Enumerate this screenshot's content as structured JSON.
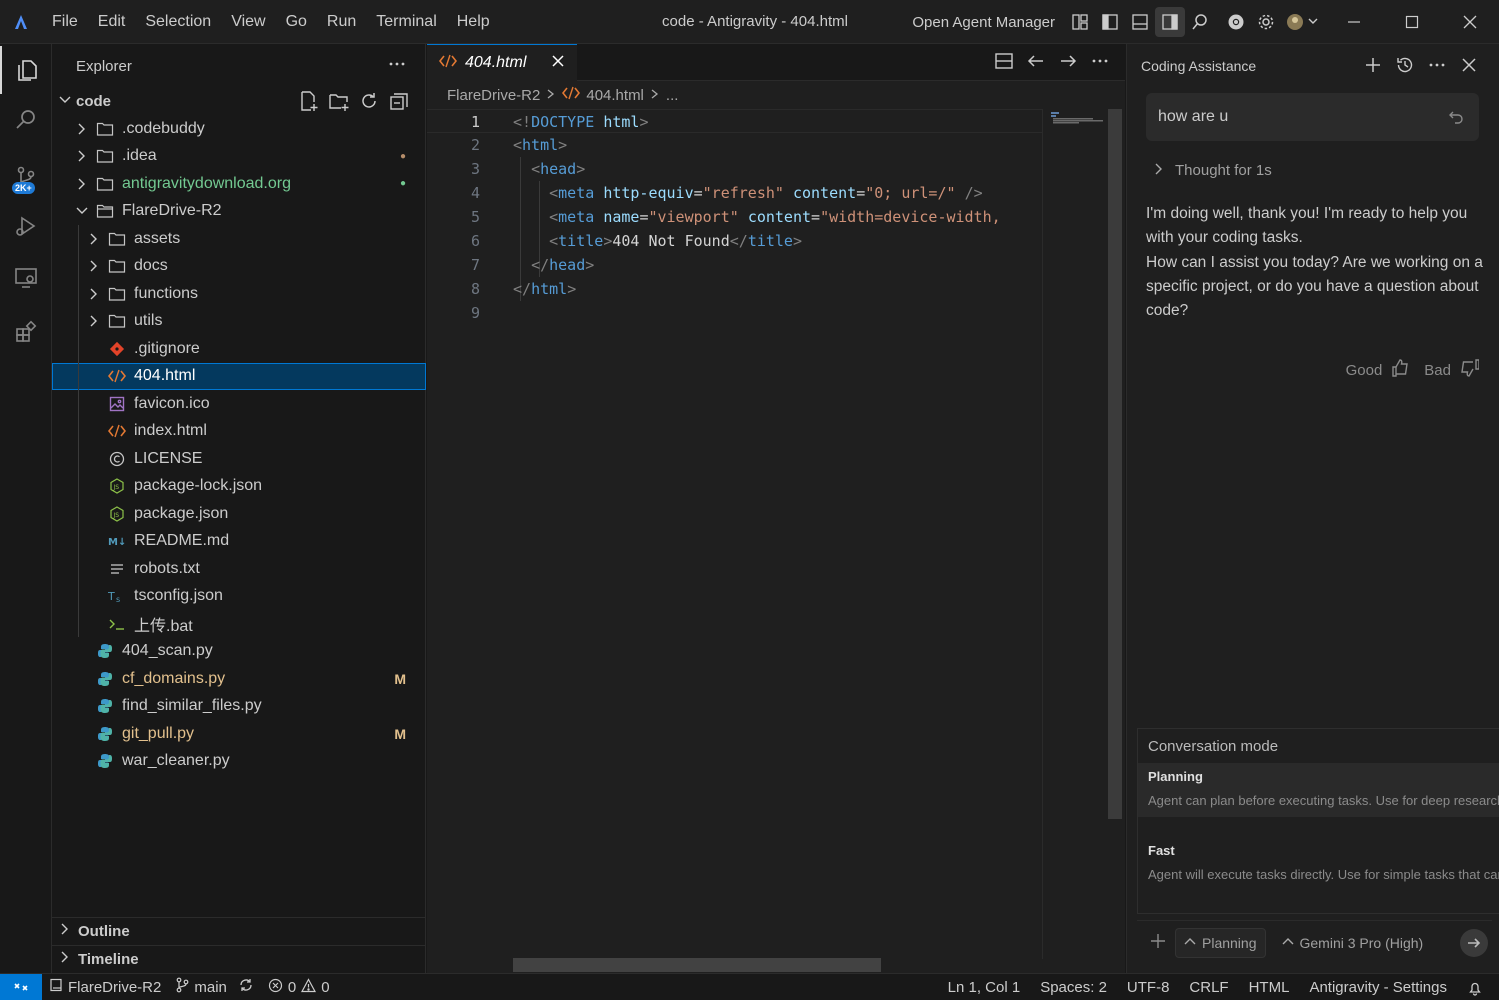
{
  "titlebar": {
    "menu": [
      "File",
      "Edit",
      "Selection",
      "View",
      "Go",
      "Run",
      "Terminal",
      "Help"
    ],
    "window_title": "code - Antigravity - 404.html",
    "open_agent_manager": "Open Agent Manager"
  },
  "activity_bar": {
    "badge": "2K+"
  },
  "explorer": {
    "title": "Explorer",
    "root": "code",
    "items": [
      {
        "name": ".codebuddy",
        "type": "folder",
        "color": "#cccccc",
        "decoration": ""
      },
      {
        "name": ".idea",
        "type": "folder",
        "color": "#cccccc",
        "decoration": "●"
      },
      {
        "name": "antigravitydownload.org",
        "type": "folder",
        "color": "#73c991",
        "decoration": "●"
      },
      {
        "name": "FlareDrive-R2",
        "type": "folder-open",
        "color": "#cccccc",
        "decoration": ""
      },
      {
        "name": "assets",
        "type": "folder",
        "color": "#cccccc",
        "decoration": ""
      },
      {
        "name": "docs",
        "type": "folder",
        "color": "#cccccc",
        "decoration": ""
      },
      {
        "name": "functions",
        "type": "folder",
        "color": "#cccccc",
        "decoration": ""
      },
      {
        "name": "utils",
        "type": "folder",
        "color": "#cccccc",
        "decoration": ""
      },
      {
        "name": ".gitignore",
        "type": "git",
        "color": "#cccccc",
        "decoration": ""
      },
      {
        "name": "404.html",
        "type": "html",
        "color": "#ffffff",
        "decoration": ""
      },
      {
        "name": "favicon.ico",
        "type": "image",
        "color": "#cccccc",
        "decoration": ""
      },
      {
        "name": "index.html",
        "type": "html",
        "color": "#cccccc",
        "decoration": ""
      },
      {
        "name": "LICENSE",
        "type": "license",
        "color": "#cccccc",
        "decoration": ""
      },
      {
        "name": "package-lock.json",
        "type": "node",
        "color": "#cccccc",
        "decoration": ""
      },
      {
        "name": "package.json",
        "type": "node",
        "color": "#cccccc",
        "decoration": ""
      },
      {
        "name": "README.md",
        "type": "markdown",
        "color": "#cccccc",
        "decoration": ""
      },
      {
        "name": "robots.txt",
        "type": "text",
        "color": "#cccccc",
        "decoration": ""
      },
      {
        "name": "tsconfig.json",
        "type": "tsconfig",
        "color": "#cccccc",
        "decoration": ""
      },
      {
        "name": "上传.bat",
        "type": "bat",
        "color": "#cccccc",
        "decoration": ""
      },
      {
        "name": "404_scan.py",
        "type": "python",
        "color": "#cccccc",
        "decoration": ""
      },
      {
        "name": "cf_domains.py",
        "type": "python",
        "color": "#e2c08d",
        "decoration": "M"
      },
      {
        "name": "find_similar_files.py",
        "type": "python",
        "color": "#cccccc",
        "decoration": ""
      },
      {
        "name": "git_pull.py",
        "type": "python",
        "color": "#e2c08d",
        "decoration": "M"
      },
      {
        "name": "war_cleaner.py",
        "type": "python",
        "color": "#cccccc",
        "decoration": ""
      }
    ],
    "outline": "Outline",
    "timeline": "Timeline"
  },
  "editor": {
    "tab_label": "404.html",
    "breadcrumb": [
      "FlareDrive-R2",
      "404.html",
      "..."
    ],
    "line_numbers": [
      "1",
      "2",
      "3",
      "4",
      "5",
      "6",
      "7",
      "8",
      "9"
    ]
  },
  "chat": {
    "title": "Coding Assistance",
    "user_message": "how are u",
    "thought": "Thought for 1s",
    "reply": [
      "I'm doing well, thank you! I'm ready to help you with your coding tasks.",
      "How can I assist you today? Are we working on a specific project, or do you have a question about code?"
    ],
    "good": "Good",
    "bad": "Bad",
    "mode_title": "Conversation mode",
    "modes": [
      {
        "name": "Planning",
        "description": "Agent can plan before executing tasks. Use for deep research, complex tasks, or collaborative work"
      },
      {
        "name": "Fast",
        "description": "Agent will execute tasks directly. Use for simple tasks that can be completed faster"
      }
    ],
    "mode_selected": "Planning",
    "model": "Gemini 3 Pro (High)"
  },
  "statusbar": {
    "project": "FlareDrive-R2",
    "branch": "main",
    "errors": "0",
    "warnings": "0",
    "position": "Ln 1, Col 1",
    "spaces": "Spaces: 2",
    "encoding": "UTF-8",
    "eol": "CRLF",
    "language": "HTML",
    "settings": "Antigravity - Settings"
  }
}
